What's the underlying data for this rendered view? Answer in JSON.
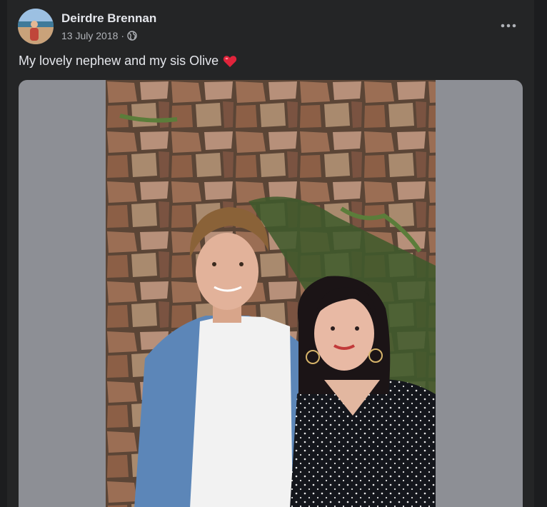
{
  "post": {
    "author": "Deirdre Brennan",
    "date": "13 July 2018",
    "separator": "·",
    "privacy_icon": "globe-icon",
    "more_icon": "more-options-icon",
    "caption": "My lovely nephew and my sis Olive",
    "caption_emoji": "heart-icon",
    "photo_alt": "Young man in blue shirt and woman in polka-dot top standing in front of a stone wall"
  },
  "colors": {
    "card_bg": "#242526",
    "text_primary": "#e4e6eb",
    "text_secondary": "#b0b3b8",
    "media_bg": "#8d8f95",
    "heart": "#e0243b"
  }
}
